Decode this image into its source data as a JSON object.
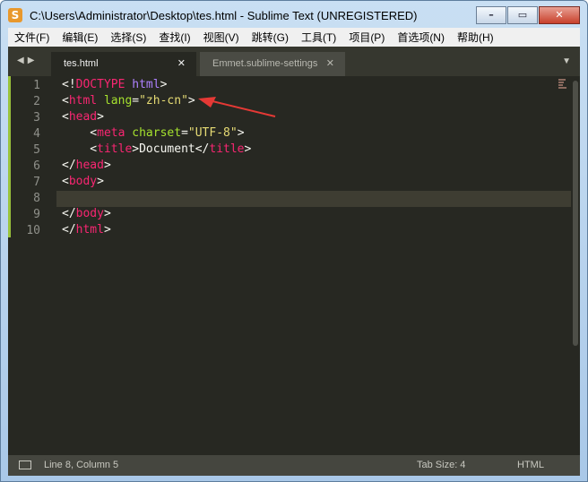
{
  "window": {
    "title": "C:\\Users\\Administrator\\Desktop\\tes.html - Sublime Text (UNREGISTERED)",
    "app_icon": "sublime-s-icon",
    "buttons": {
      "minimize": "–",
      "maximize": "▭",
      "close": "✕"
    }
  },
  "menu": [
    "文件(F)",
    "编辑(E)",
    "选择(S)",
    "查找(I)",
    "视图(V)",
    "跳转(G)",
    "工具(T)",
    "项目(P)",
    "首选项(N)",
    "帮助(H)"
  ],
  "tabs": [
    {
      "label": "tes.html",
      "active": true
    },
    {
      "label": "Emmet.sublime-settings",
      "active": false
    }
  ],
  "icons": {
    "nav_left": "◀",
    "nav_right": "▶",
    "tab_close": "✕",
    "tab_menu": "▼"
  },
  "editor": {
    "line_numbers": [
      "1",
      "2",
      "3",
      "4",
      "5",
      "6",
      "7",
      "8",
      "9",
      "10"
    ],
    "current_line": 8,
    "lines": [
      [
        {
          "t": "<!",
          "c": "punct"
        },
        {
          "t": "DOCTYPE",
          "c": "doctype"
        },
        {
          "t": " html",
          "c": "doctype2"
        },
        {
          "t": ">",
          "c": "punct"
        }
      ],
      [
        {
          "t": "<",
          "c": "punct"
        },
        {
          "t": "html",
          "c": "tag"
        },
        {
          "t": " lang",
          "c": "attr"
        },
        {
          "t": "=",
          "c": "punct"
        },
        {
          "t": "\"zh-cn\"",
          "c": "str"
        },
        {
          "t": ">",
          "c": "punct"
        }
      ],
      [
        {
          "t": "<",
          "c": "punct"
        },
        {
          "t": "head",
          "c": "tag"
        },
        {
          "t": ">",
          "c": "punct"
        }
      ],
      [
        {
          "t": "    <",
          "c": "punct"
        },
        {
          "t": "meta",
          "c": "tag"
        },
        {
          "t": " charset",
          "c": "attr"
        },
        {
          "t": "=",
          "c": "punct"
        },
        {
          "t": "\"UTF-8\"",
          "c": "str"
        },
        {
          "t": ">",
          "c": "punct"
        }
      ],
      [
        {
          "t": "    <",
          "c": "punct"
        },
        {
          "t": "title",
          "c": "tag"
        },
        {
          "t": ">Document</",
          "c": "punct"
        },
        {
          "t": "title",
          "c": "tag"
        },
        {
          "t": ">",
          "c": "punct"
        }
      ],
      [
        {
          "t": "</",
          "c": "punct"
        },
        {
          "t": "head",
          "c": "tag"
        },
        {
          "t": ">",
          "c": "punct"
        }
      ],
      [
        {
          "t": "<",
          "c": "punct"
        },
        {
          "t": "body",
          "c": "tag"
        },
        {
          "t": ">",
          "c": "punct"
        }
      ],
      [],
      [
        {
          "t": "</",
          "c": "punct"
        },
        {
          "t": "body",
          "c": "tag"
        },
        {
          "t": ">",
          "c": "punct"
        }
      ],
      [
        {
          "t": "</",
          "c": "punct"
        },
        {
          "t": "html",
          "c": "tag"
        },
        {
          "t": ">",
          "c": "punct"
        }
      ]
    ],
    "annotation": "red-arrow-pointer"
  },
  "status": {
    "icon": "panel-toggle-icon",
    "position": "Line 8, Column 5",
    "tab_size": "Tab Size: 4",
    "syntax": "HTML"
  },
  "colors": {
    "tag": "#f92672",
    "attr": "#a6e22e",
    "str": "#e6db74",
    "doctype2": "#ae81ff",
    "bg": "#272822",
    "arrow": "#e53935"
  }
}
